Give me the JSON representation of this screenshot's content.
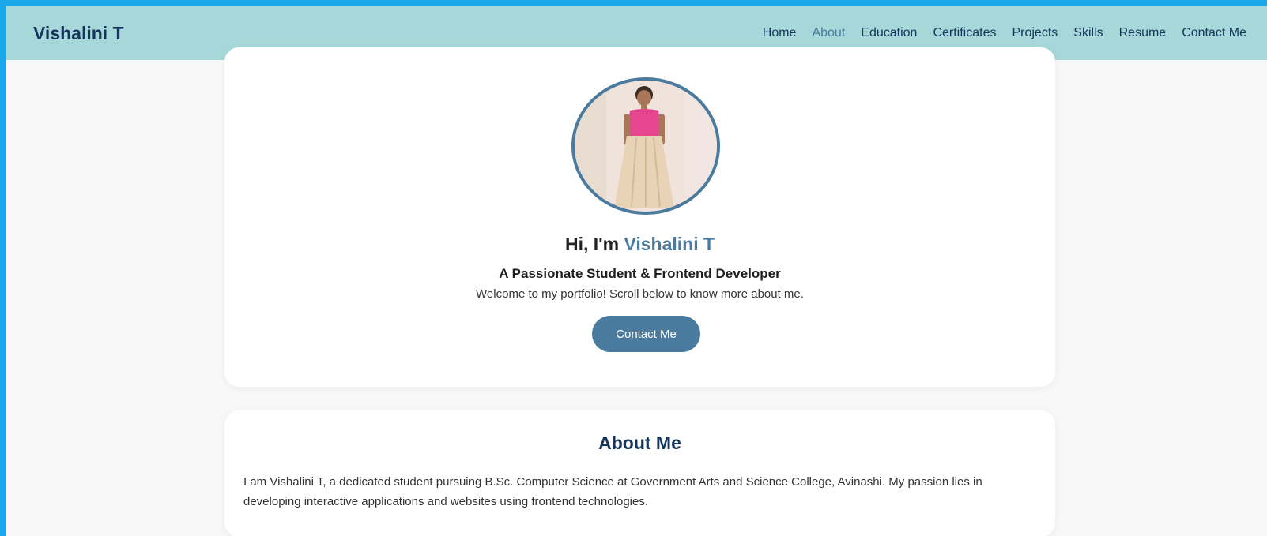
{
  "brand": "Vishalini T",
  "nav": {
    "items": [
      {
        "label": "Home"
      },
      {
        "label": "About"
      },
      {
        "label": "Education"
      },
      {
        "label": "Certificates"
      },
      {
        "label": "Projects"
      },
      {
        "label": "Skills"
      },
      {
        "label": "Resume"
      },
      {
        "label": "Contact Me"
      }
    ],
    "active": "About"
  },
  "hero": {
    "greeting": "Hi, I'm",
    "name": "Vishalini T",
    "subtitle": "A Passionate Student & Frontend Developer",
    "welcome": "Welcome to my portfolio! Scroll below to know more about me.",
    "button": "Contact Me"
  },
  "about": {
    "title": "About Me",
    "text": "I am Vishalini T, a dedicated student pursuing B.Sc. Computer Science at Government Arts and Science College, Avinashi. My passion lies in developing interactive applications and websites using frontend technologies."
  },
  "colors": {
    "navbar_bg": "#a7d8d9",
    "accent": "#4a7a9d",
    "heading": "#15355a",
    "outer_border": "#1aa7ea"
  }
}
